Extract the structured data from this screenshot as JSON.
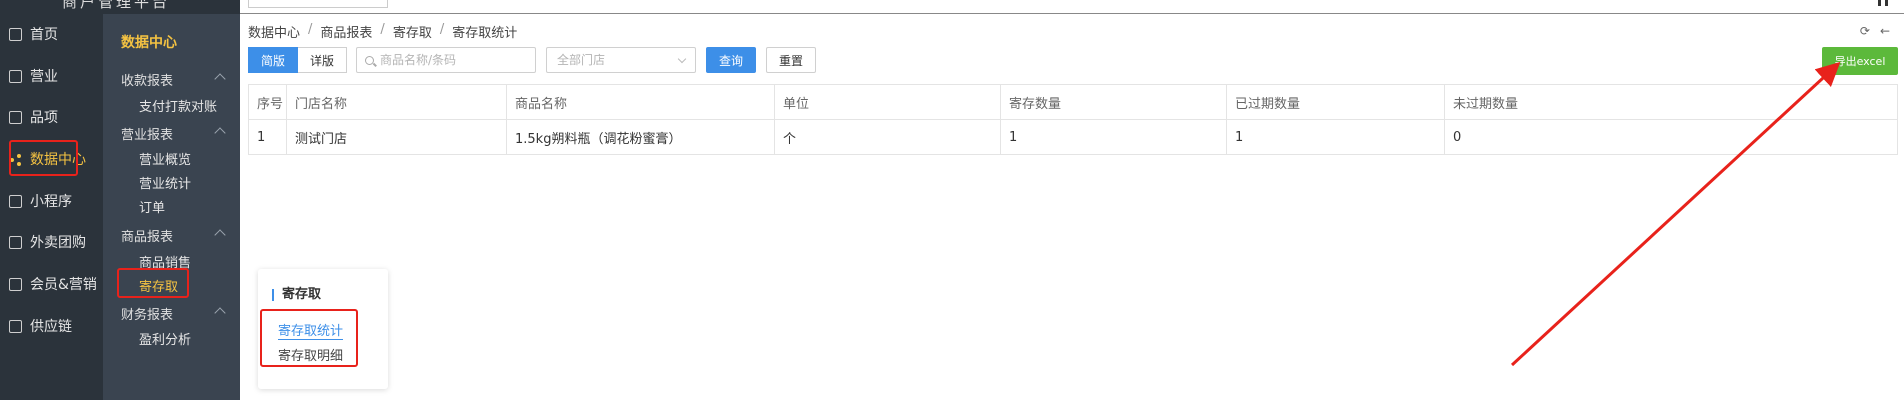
{
  "topbar": {
    "brand": "商户管理平台"
  },
  "rail": {
    "items": [
      {
        "label": "首页",
        "icon": "home-icon"
      },
      {
        "label": "营业",
        "icon": "business-icon"
      },
      {
        "label": "品项",
        "icon": "bag-icon"
      },
      {
        "label": "数据中心",
        "icon": "share-icon",
        "active": true
      },
      {
        "label": "小程序",
        "icon": "phone-icon"
      },
      {
        "label": "外卖团购",
        "icon": "bike-icon"
      },
      {
        "label": "会员&营销",
        "icon": "user-icon"
      },
      {
        "label": "供应链",
        "icon": "truck-icon"
      }
    ]
  },
  "subnav": {
    "title": "数据中心",
    "groups": [
      {
        "label": "收款报表",
        "items": [
          "支付打款对账"
        ]
      },
      {
        "label": "营业报表",
        "items": [
          "营业概览",
          "营业统计",
          "订单"
        ]
      },
      {
        "label": "商品报表",
        "items": [
          "商品销售",
          "寄存取"
        ]
      },
      {
        "label": "财务报表",
        "items": [
          "盈利分析"
        ]
      }
    ],
    "active_item": "寄存取"
  },
  "breadcrumb": [
    "数据中心",
    "商品报表",
    "寄存取",
    "寄存取统计"
  ],
  "toolbar": {
    "seg_simple": "简版",
    "seg_detail": "详版",
    "search_placeholder": "商品名称/条码",
    "store_placeholder": "全部门店",
    "query_label": "查询",
    "reset_label": "重置",
    "export_label": "导出excel"
  },
  "table": {
    "headers": [
      "序号",
      "门店名称",
      "商品名称",
      "单位",
      "寄存数量",
      "已过期数量",
      "未过期数量"
    ],
    "rows": [
      [
        "1",
        "测试门店",
        "1.5kg朔料瓶（调花粉蜜膏）",
        "个",
        "1",
        "1",
        "0"
      ]
    ]
  },
  "popup": {
    "title": "寄存取",
    "links": [
      "寄存取统计",
      "寄存取明细"
    ]
  },
  "colors": {
    "accent": "#3d8fe8",
    "export": "#5cb93b",
    "highlight": "#e8221b",
    "sidebar": "#2b333b",
    "active": "#f5c342"
  }
}
